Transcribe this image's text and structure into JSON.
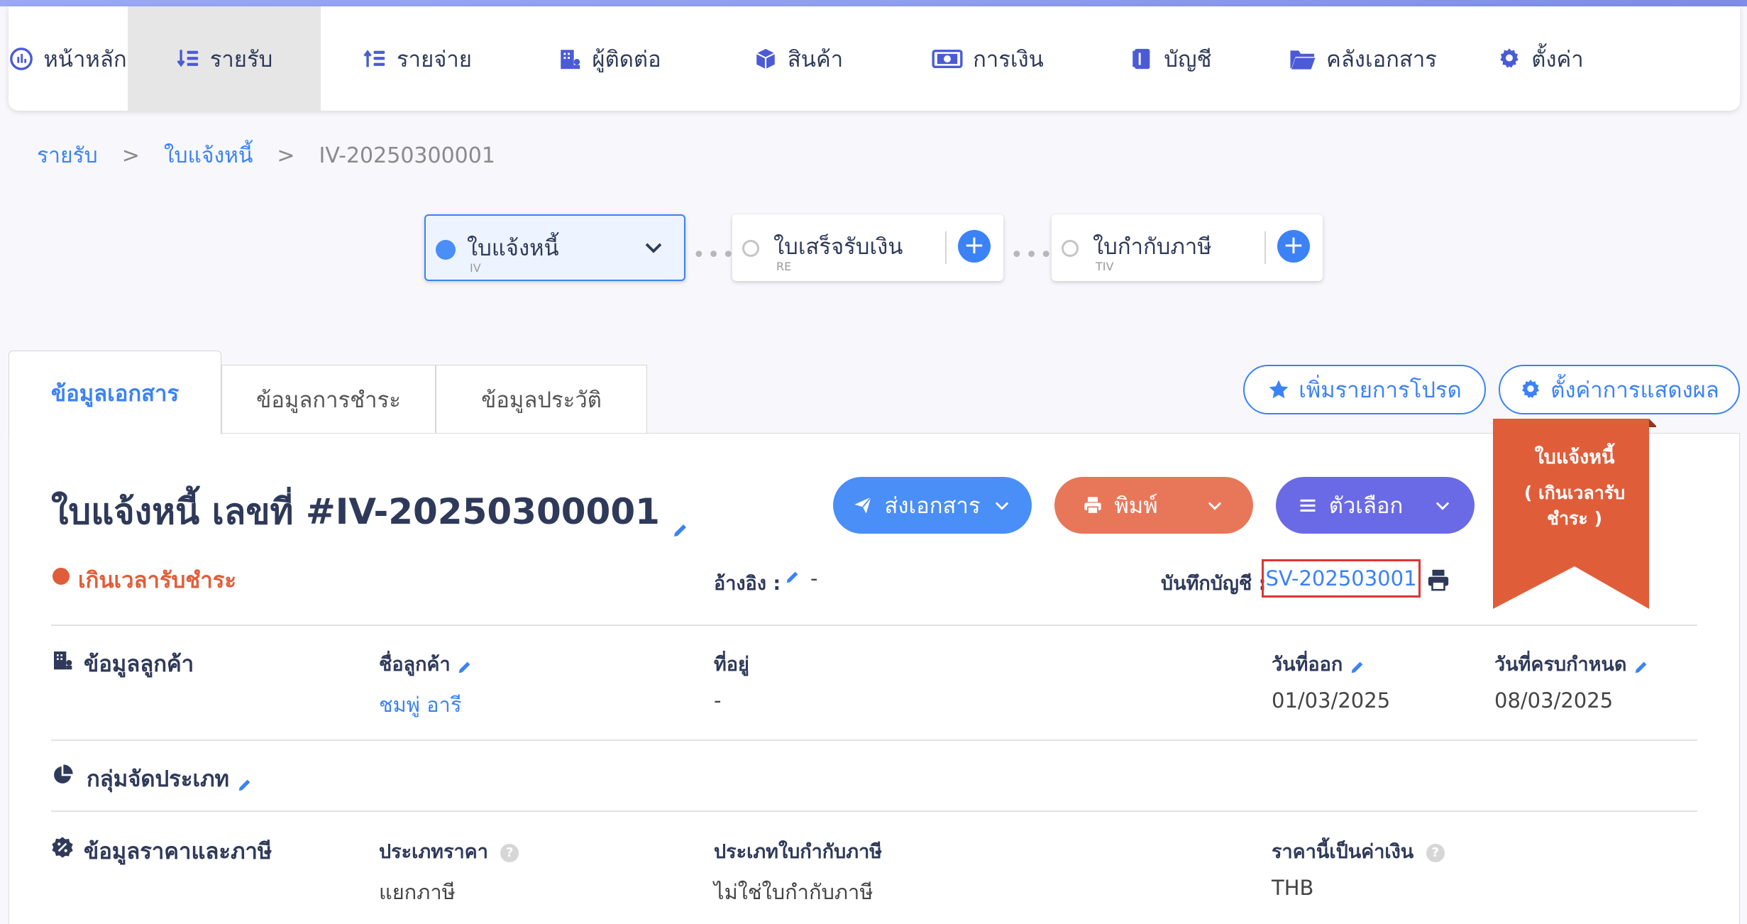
{
  "nav": {
    "items": [
      {
        "label": "หน้าหลัก",
        "icon": "dashboard-icon"
      },
      {
        "label": "รายรับ",
        "icon": "income-icon"
      },
      {
        "label": "รายจ่าย",
        "icon": "expense-icon"
      },
      {
        "label": "ผู้ติดต่อ",
        "icon": "building-icon"
      },
      {
        "label": "สินค้า",
        "icon": "box-icon"
      },
      {
        "label": "การเงิน",
        "icon": "money-icon"
      },
      {
        "label": "บัญชี",
        "icon": "ledger-icon"
      },
      {
        "label": "คลังเอกสาร",
        "icon": "folder-icon"
      },
      {
        "label": "ตั้งค่า",
        "icon": "gear-icon"
      }
    ],
    "active_index": 1
  },
  "breadcrumb": {
    "level1": "รายรับ",
    "level2": "ใบแจ้งหนี้",
    "level3": "IV-20250300001",
    "separator": ">"
  },
  "flow": {
    "steps": [
      {
        "title": "ใบแจ้งหนี้",
        "code": "IV"
      },
      {
        "title": "ใบเสร็จรับเงิน",
        "code": "RE"
      },
      {
        "title": "ใบกำกับภาษี",
        "code": "TIV"
      }
    ],
    "plus": "+",
    "dots": "•••"
  },
  "tabs": [
    "ข้อมูลเอกสาร",
    "ข้อมูลการชำระ",
    "ข้อมูลประวัติ"
  ],
  "actions": {
    "favorite_label": "เพิ่มรายการโปรด",
    "display_settings_label": "ตั้งค่าการแสดงผล",
    "send_label": "ส่งเอกสาร",
    "print_label": "พิมพ์",
    "options_label": "ตัวเลือก"
  },
  "ribbon": {
    "title": "ใบแจ้งหนี้",
    "line1": "( เกินเวลารับ",
    "line2": "ชำระ )",
    "color": "#e05d3a"
  },
  "document": {
    "title": "ใบแจ้งหนี้ เลขที่ #IV-20250300001",
    "status": "เกินเวลารับชำระ",
    "reference_label": "อ้างอิง :",
    "reference_value": "-",
    "account_label": "บันทึกบัญชี :",
    "account_value": "SV-202503001"
  },
  "customer": {
    "section_title": "ข้อมูลลูกค้า",
    "name_label": "ชื่อลูกค้า",
    "name_value": "ชมพู่ อารี",
    "address_label": "ที่อยู่",
    "address_value": "-",
    "issue_date_label": "วันที่ออก",
    "issue_date_value": "01/03/2025",
    "due_date_label": "วันที่ครบกำหนด",
    "due_date_value": "08/03/2025"
  },
  "category": {
    "section_title": "กลุ่มจัดประเภท"
  },
  "pricing": {
    "section_title": "ข้อมูลราคาและภาษี",
    "price_type_label": "ประเภทราคา",
    "price_type_value": "แยกภาษี",
    "tax_invoice_type_label": "ประเภทใบกำกับภาษี",
    "tax_invoice_type_value": "ไม่ใช่ใบกำกับภาษี",
    "currency_label": "ราคานี้เป็นค่าเงิน",
    "currency_value": "THB",
    "help": "?"
  },
  "colors": {
    "accent": "#3b82f6",
    "send": "#4a8ef7",
    "print": "#e8775a",
    "options": "#6a6ae6",
    "status": "#e05d3a",
    "text_dark": "#2f3a5a"
  }
}
